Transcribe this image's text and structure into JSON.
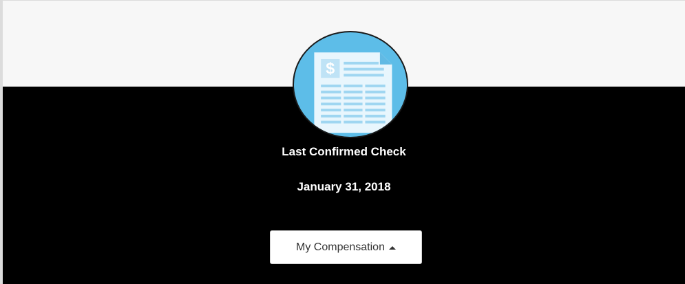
{
  "card": {
    "icon": "check-document-icon",
    "title": "Last Confirmed Check",
    "date": "January 31, 2018",
    "button_label": "My Compensation",
    "button_icon": "caret-up-icon"
  },
  "colors": {
    "icon_background": "#5dbde8",
    "panel_background": "#000000",
    "header_background": "#f7f7f7"
  }
}
